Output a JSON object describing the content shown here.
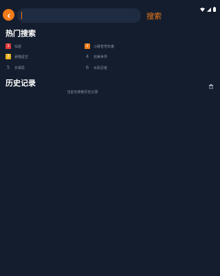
{
  "search": {
    "placeholder": "",
    "value": "",
    "button_label": "搜索"
  },
  "hot": {
    "title": "热门搜索",
    "items": [
      {
        "rank": "1",
        "label": "仙逆",
        "rank_color": "#e03a3a"
      },
      {
        "rank": "2",
        "label": "斗破苍穹年番",
        "rank_color": "#f07b18"
      },
      {
        "rank": "3",
        "label": "吞噬星空",
        "rank_color": "#e8b21c"
      },
      {
        "rank": "4",
        "label": "完美世界",
        "rank_color": ""
      },
      {
        "rank": "5",
        "label": "长相思",
        "rank_color": ""
      },
      {
        "rank": "6",
        "label": "水影忍者",
        "rank_color": ""
      }
    ]
  },
  "history": {
    "title": "历史记录",
    "empty_text": "当前无搜索历史记录"
  },
  "icons": {
    "back": "arrow-left-icon",
    "clear_history": "trash-icon",
    "wifi": "wifi-icon",
    "signal": "signal-icon",
    "battery": "battery-icon"
  },
  "colors": {
    "accent": "#f07b18",
    "background": "#141d2e"
  }
}
